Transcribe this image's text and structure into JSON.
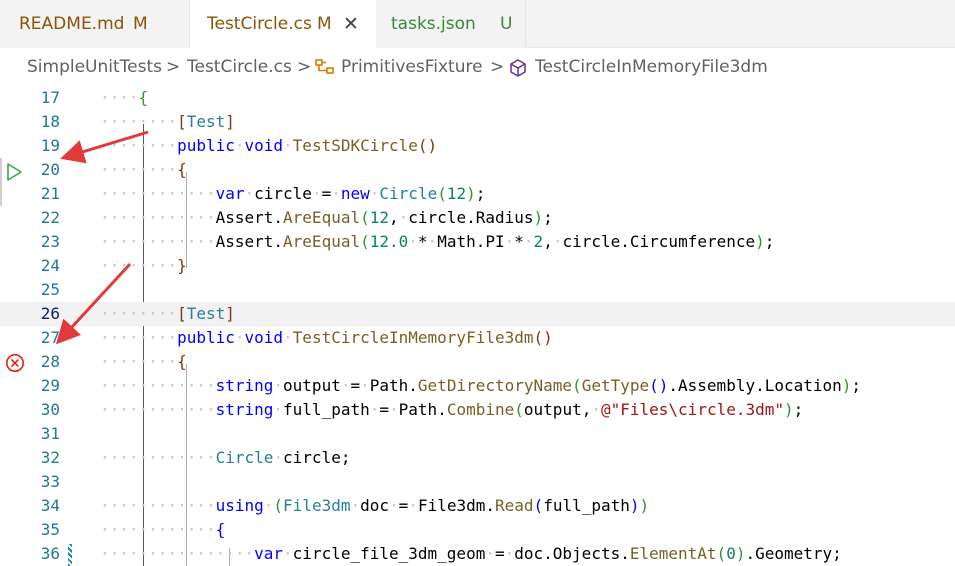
{
  "tabs": [
    {
      "label": "README.md",
      "badge": "M",
      "state": "modified",
      "active": false
    },
    {
      "label": "TestCircle.cs",
      "badge": "M",
      "state": "modified",
      "active": true,
      "close_icon": "close-icon"
    },
    {
      "label": "tasks.json",
      "badge": "U",
      "state": "untracked",
      "active": false
    }
  ],
  "breadcrumb": {
    "items": [
      "SimpleUnitTests",
      "TestCircle.cs",
      "PrimitivesFixture",
      "TestCircleInMemoryFile3dm"
    ],
    "separator": ">",
    "icons": [
      "namespace-icon",
      "method-cube-icon"
    ]
  },
  "editor": {
    "current_line": "26",
    "lines": [
      {
        "n": "17",
        "text": "{"
      },
      {
        "n": "18",
        "text": "[Test]"
      },
      {
        "n": "19",
        "text": "public void TestSDKCircle()"
      },
      {
        "n": "20",
        "text": "{"
      },
      {
        "n": "21",
        "text": "var circle = new Circle(12);"
      },
      {
        "n": "22",
        "text": "Assert.AreEqual(12, circle.Radius);"
      },
      {
        "n": "23",
        "text": "Assert.AreEqual(12.0 * Math.PI * 2, circle.Circumference);"
      },
      {
        "n": "24",
        "text": "}"
      },
      {
        "n": "25",
        "text": ""
      },
      {
        "n": "26",
        "text": "[Test]"
      },
      {
        "n": "27",
        "text": "public void TestCircleInMemoryFile3dm()"
      },
      {
        "n": "28",
        "text": "{"
      },
      {
        "n": "29",
        "text": "string output = Path.GetDirectoryName(GetType().Assembly.Location);"
      },
      {
        "n": "30",
        "text": "string full_path = Path.Combine(output, @\"Files\\circle.3dm\");"
      },
      {
        "n": "31",
        "text": ""
      },
      {
        "n": "32",
        "text": "Circle circle;"
      },
      {
        "n": "33",
        "text": ""
      },
      {
        "n": "34",
        "text": "using (File3dm doc = File3dm.Read(full_path))"
      },
      {
        "n": "35",
        "text": "{"
      },
      {
        "n": "36",
        "text": "var circle_file_3dm_geom = doc.Objects.ElementAt(0).Geometry;"
      }
    ]
  },
  "gutter": {
    "run_test_icon_line": "20",
    "failed_test_icon_line": "28",
    "icons": [
      "run-test-icon",
      "test-failed-icon"
    ]
  },
  "colors": {
    "modified": "#895503",
    "untracked": "#388a34",
    "keyword": "#0000ff",
    "type": "#267f99",
    "function": "#795e26",
    "string": "#a31515",
    "number": "#098658",
    "arrow": "#e03a3a",
    "run_icon": "#3fa34d",
    "fail_icon": "#e51400"
  }
}
